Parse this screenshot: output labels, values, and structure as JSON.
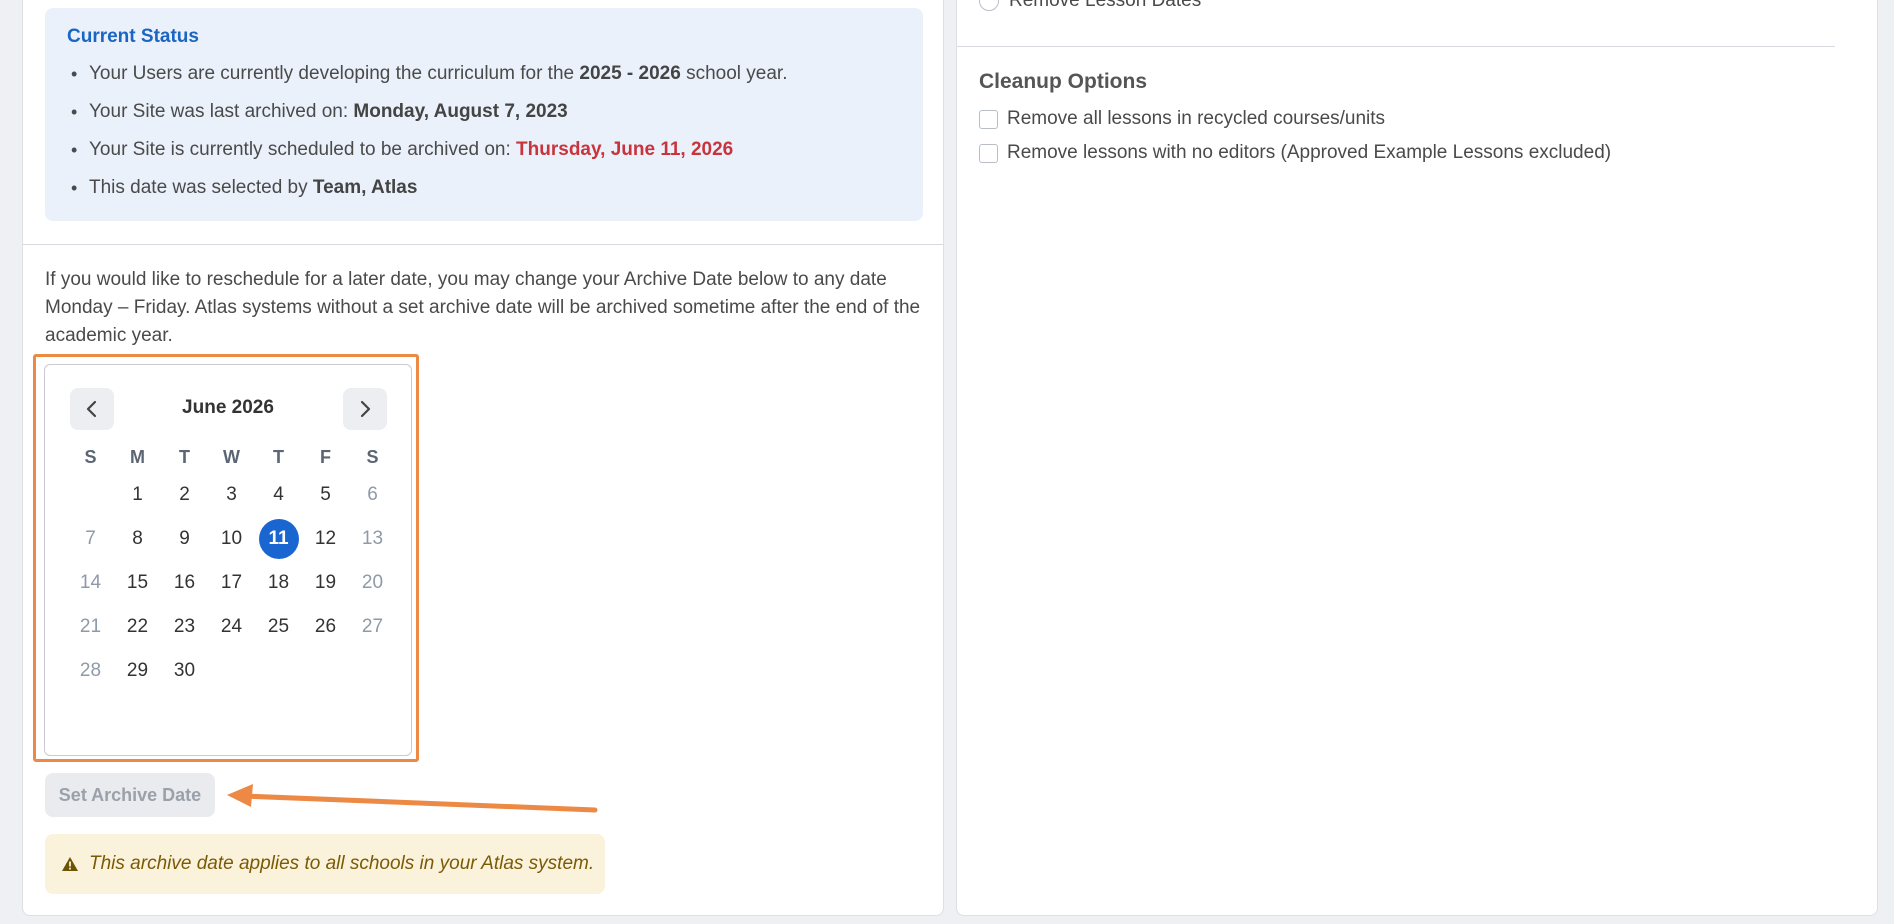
{
  "status": {
    "title": "Current Status",
    "line1_pre": "Your Users are currently developing the curriculum for the ",
    "line1_bold": "2025 - 2026",
    "line1_post": " school year.",
    "line2_pre": "Your Site was last archived on: ",
    "line2_bold": "Monday, August 7, 2023",
    "line3_pre": "Your Site is currently scheduled to be archived on: ",
    "line3_bold": "Thursday, June 11, 2026",
    "line4_pre": "This date was selected by ",
    "line4_bold": "Team, Atlas"
  },
  "description": "If you would like to reschedule for a later date, you may change your Archive Date below to any date Monday – Friday. Atlas systems without a set archive date will be archived sometime after the end of the academic year.",
  "calendar": {
    "month_label": "June 2026",
    "weekdays": [
      "S",
      "M",
      "T",
      "W",
      "T",
      "F",
      "S"
    ],
    "leading_blanks": 1,
    "days_in_month": 30,
    "selected_day": 11
  },
  "set_button_label": "Set Archive Date",
  "warning_text": "This archive date applies to all schools in your Atlas system.",
  "right": {
    "clipped_option": "Remove Lesson Dates",
    "cleanup_title": "Cleanup Options",
    "options": [
      "Remove all lessons in recycled courses/units",
      "Remove lessons with no editors (Approved Example Lessons excluded)"
    ]
  },
  "colors": {
    "accent_blue": "#1a66d0",
    "highlight_orange": "#ec8a45",
    "alert_red": "#c9343c",
    "warning_bg": "#fbf2dc"
  }
}
